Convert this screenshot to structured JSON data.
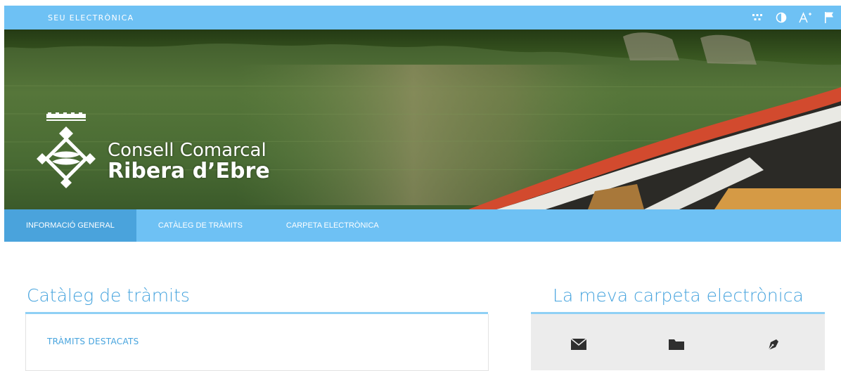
{
  "topbar": {
    "site_label": "SEU ELECTRÒNICA",
    "tools": [
      {
        "icon": "grid-dots-icon"
      },
      {
        "icon": "contrast-icon"
      },
      {
        "icon": "font-size-icon"
      },
      {
        "icon": "language-flag-icon"
      }
    ]
  },
  "banner": {
    "logo_line1": "Consell Comarcal",
    "logo_line2": "Ribera d’Ebre"
  },
  "nav": {
    "items": [
      {
        "label": "INFORMACIÓ GENERAL",
        "active": true
      },
      {
        "label": "CATÀLEG DE TRÀMITS",
        "active": false
      },
      {
        "label": "CARPETA ELECTRÒNICA",
        "active": false
      }
    ]
  },
  "catalog": {
    "title": "Catàleg de tràmits",
    "featured_label": "TRÀMITS DESTACATS"
  },
  "folder": {
    "title": "La meva carpeta electrònica",
    "icons": [
      "mail-icon",
      "folder-icon",
      "signature-pen-icon"
    ]
  },
  "colors": {
    "accent": "#6ec1f4",
    "nav_active": "#4aa3dc",
    "title_text": "#47a4de"
  }
}
